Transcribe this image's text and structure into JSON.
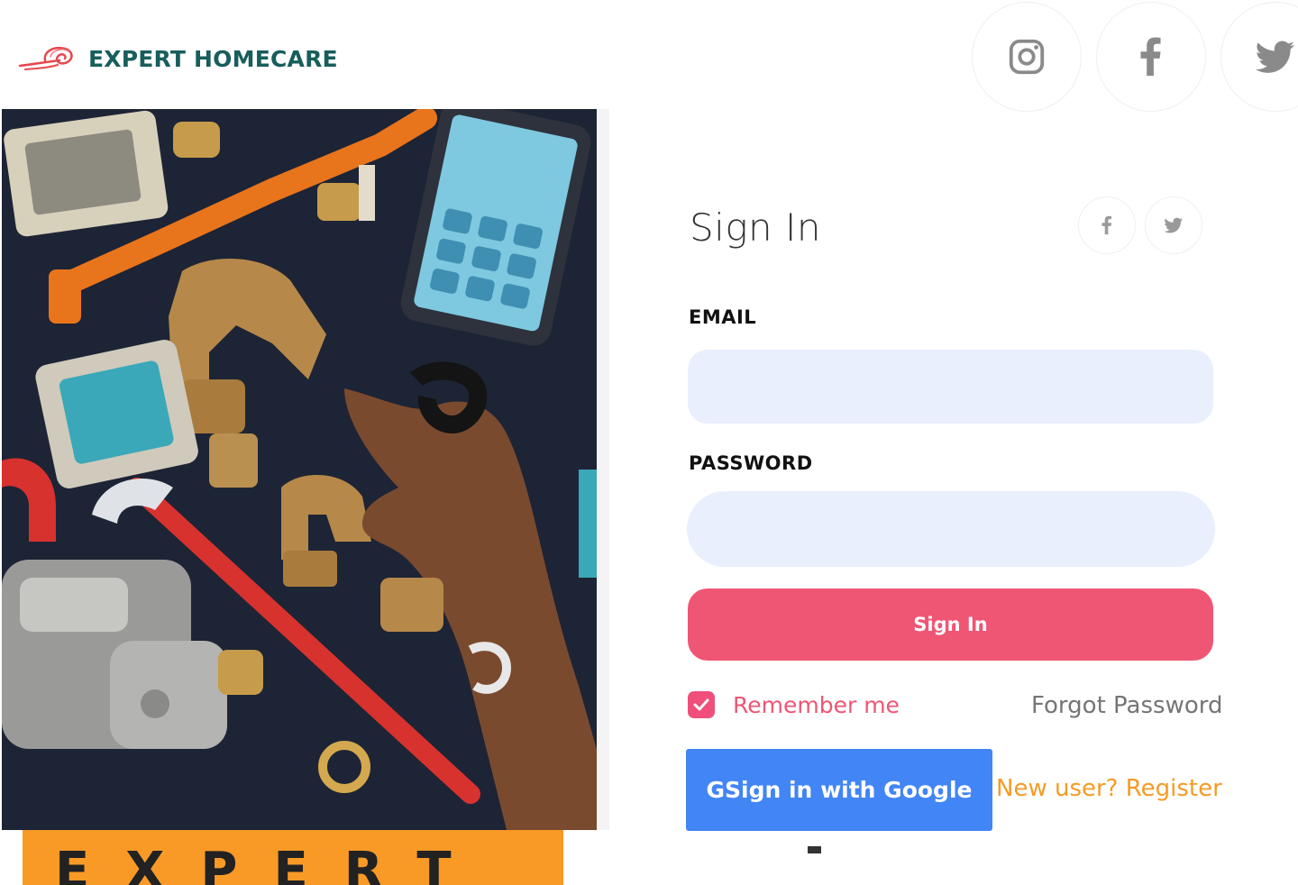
{
  "brand": {
    "name": "EXPERT HOMECARE",
    "logo_icon": "swirl-logo-icon",
    "logo_color": "#e8474f",
    "name_color": "#175e5c"
  },
  "header_social": [
    {
      "name": "instagram",
      "icon": "instagram-icon"
    },
    {
      "name": "facebook",
      "icon": "facebook-icon"
    },
    {
      "name": "twitter",
      "icon": "twitter-icon"
    }
  ],
  "hero": {
    "description_icon": "plumbing-tools-image",
    "banner_text": "EXPERT",
    "banner_color": "#f99a27"
  },
  "signin": {
    "title": "Sign In",
    "social": [
      {
        "name": "facebook",
        "icon": "facebook-icon"
      },
      {
        "name": "twitter",
        "icon": "twitter-icon"
      }
    ],
    "email_label": "EMAIL",
    "email_value": "",
    "password_label": "PASSWORD",
    "password_value": "",
    "submit_label": "Sign In",
    "remember_label": "Remember me",
    "remember_checked": true,
    "forgot_label": "Forgot Password",
    "google_label": "GSign in with Google",
    "register_label": "New user? Register"
  },
  "colors": {
    "accent": "#ef5674",
    "input_bg": "#e9effd",
    "google_blue": "#4285f4",
    "register_orange": "#f59b25"
  }
}
